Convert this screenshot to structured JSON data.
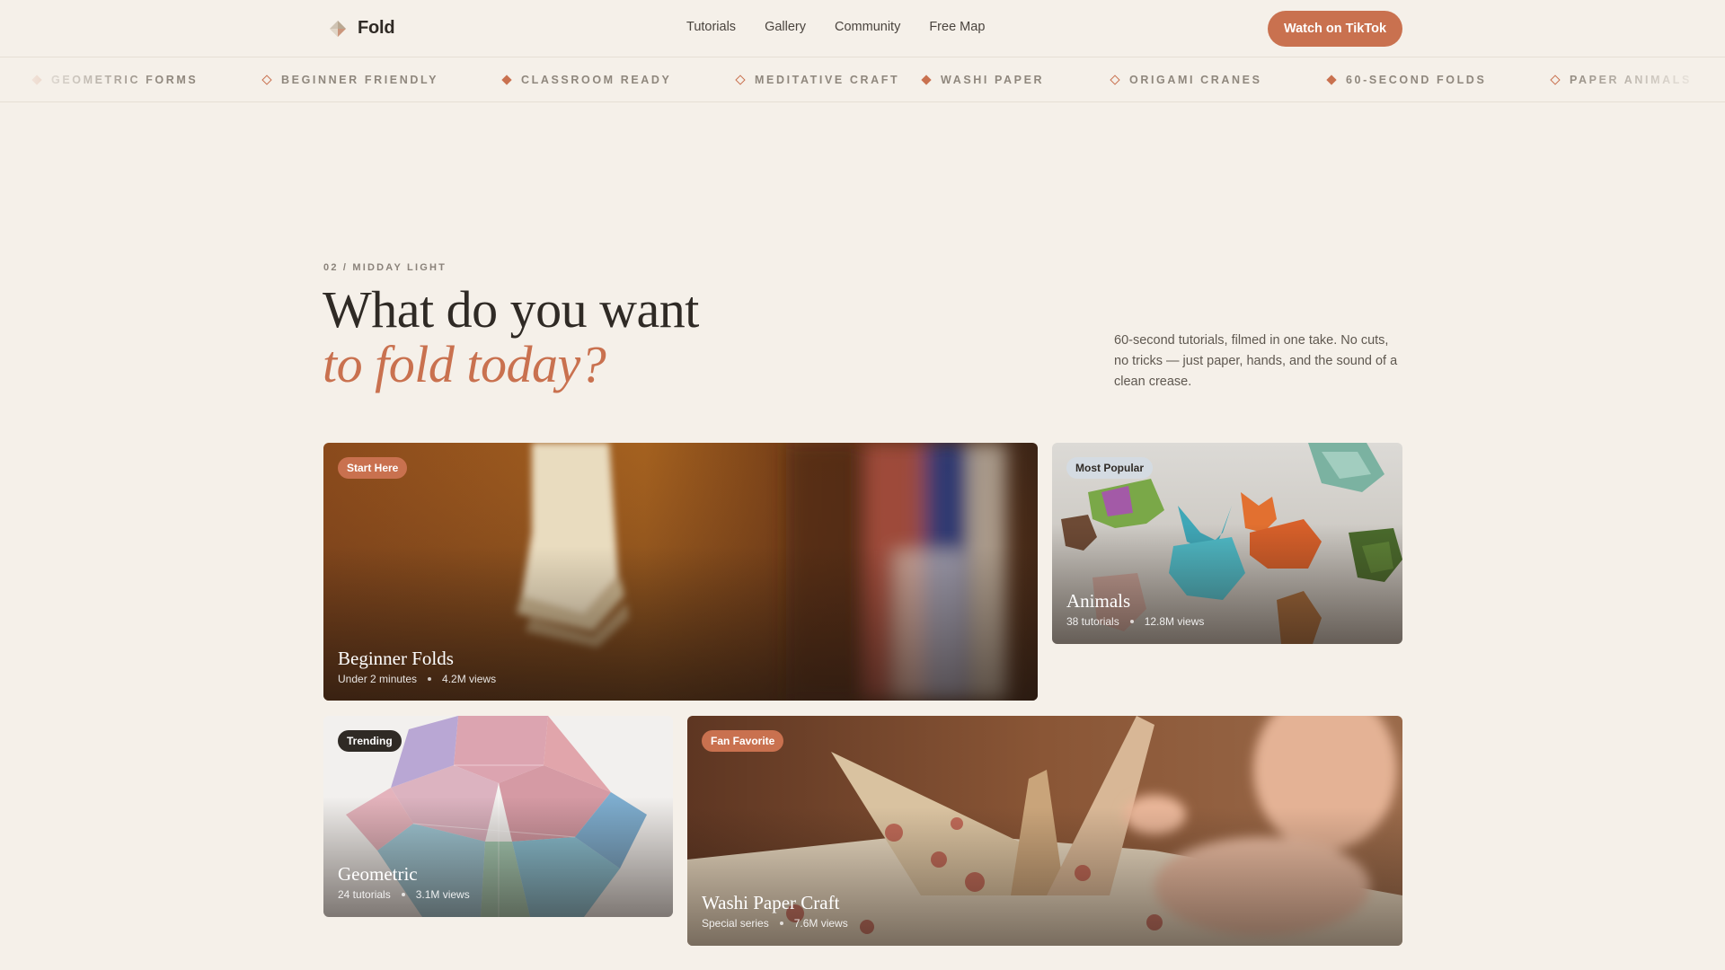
{
  "header": {
    "brand": "Fold",
    "nav": [
      "Tutorials",
      "Gallery",
      "Community",
      "Free Map"
    ],
    "cta": "Watch on TikTok"
  },
  "marquee": {
    "items": [
      {
        "label": "GEOMETRIC FORMS",
        "icon": "diamond-filled-icon"
      },
      {
        "label": "BEGINNER FRIENDLY",
        "icon": "diamond-outline-icon"
      },
      {
        "label": "CLASSROOM READY",
        "icon": "diamond-filled-icon"
      },
      {
        "label": "MEDITATIVE CRAFT",
        "icon": "diamond-outline-icon"
      },
      {
        "label": "WASHI PAPER",
        "icon": "diamond-filled-icon"
      },
      {
        "label": "ORIGAMI CRANES",
        "icon": "diamond-outline-icon"
      },
      {
        "label": "60-SECOND FOLDS",
        "icon": "diamond-filled-icon"
      },
      {
        "label": "PAPER ANIMALS",
        "icon": "diamond-outline-icon"
      }
    ]
  },
  "hero": {
    "eyebrow": "02 / MIDDAY LIGHT",
    "headline_line1": "What do you want",
    "headline_line2": "to fold today?",
    "description": "60-second tutorials, filmed in one take. No cuts, no tricks — just paper, hands, and the sound of a clean crease."
  },
  "cards": [
    {
      "badge": "Start Here",
      "title": "Beginner Folds",
      "meta1": "Under 2 minutes",
      "meta2": "4.2M views"
    },
    {
      "badge": "Most Popular",
      "title": "Animals",
      "meta1": "38 tutorials",
      "meta2": "12.8M views"
    },
    {
      "badge": "Trending",
      "title": "Geometric",
      "meta1": "24 tutorials",
      "meta2": "3.1M views"
    },
    {
      "badge": "Fan Favorite",
      "title": "Washi Paper Craft",
      "meta1": "Special series",
      "meta2": "7.6M views"
    }
  ],
  "colors": {
    "background": "#f5f0e9",
    "accent": "#c9714f",
    "text": "#2f2a25"
  }
}
